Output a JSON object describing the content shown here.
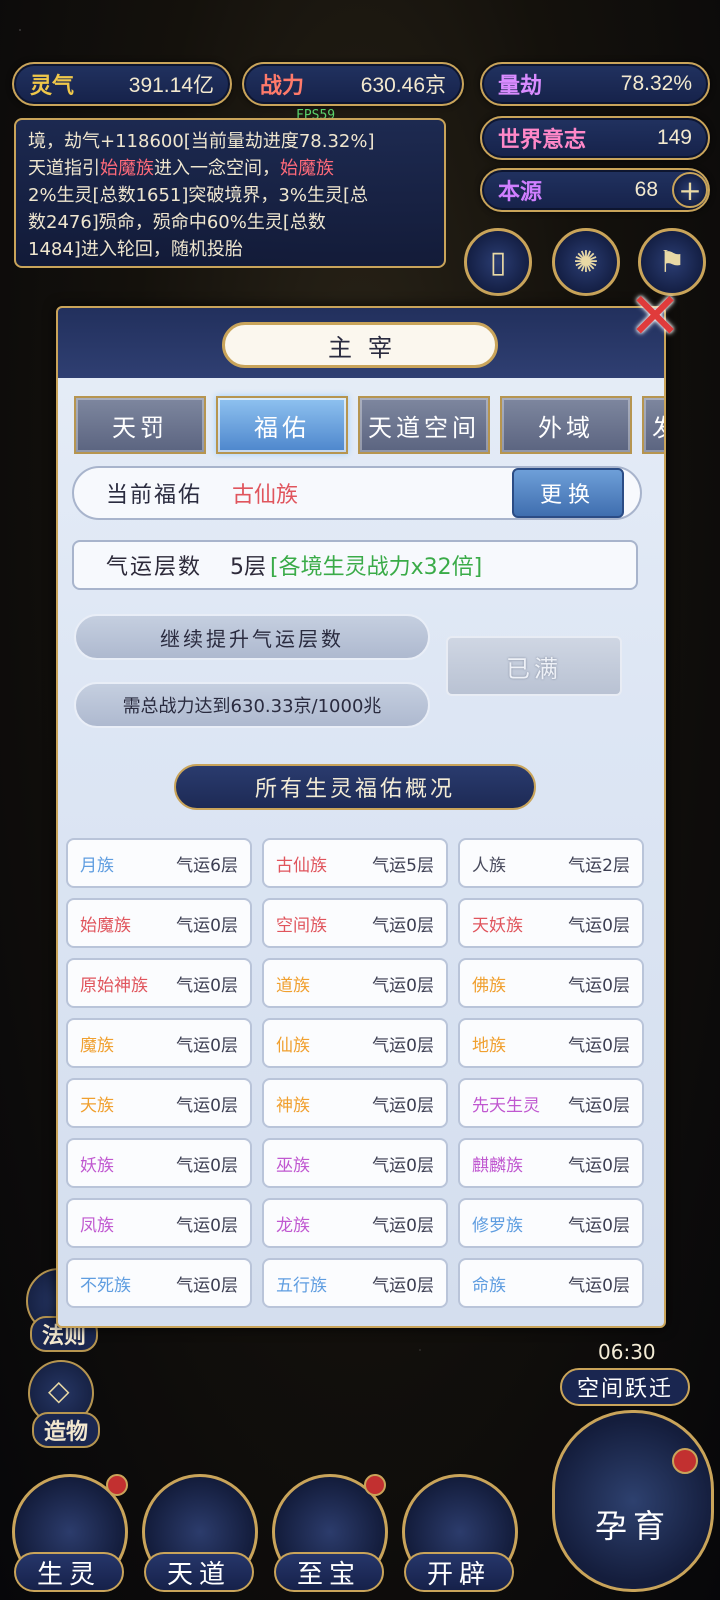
{
  "stats": {
    "lingqi": {
      "label": "灵气",
      "value": "391.14亿",
      "color": "#f0c84a"
    },
    "zhanli": {
      "label": "战力",
      "value": "630.46京",
      "color": "#ff7a6a"
    },
    "liangjie": {
      "label": "量劫",
      "value": "78.32%",
      "color": "#d98cff"
    },
    "shijie": {
      "label": "世界意志",
      "value": "149",
      "color": "#ff88c8"
    },
    "benyuan": {
      "label": "本源",
      "value": "68",
      "color": "#d07fff"
    }
  },
  "fps": "FPS59",
  "log_lines": [
    "境，劫气+118600[当前量劫进度78.32%]",
    "天道指引",
    "始魔族",
    "进入一念空间，",
    "始魔族",
    "2%生灵[总数1651]突破境界，3%生灵[总",
    "数2476]殒命，殒命中60%生灵[总数",
    "1484]进入轮回，随机投胎"
  ],
  "dialog": {
    "title": "主宰",
    "tabs": [
      "天罚",
      "福佑",
      "天道空间",
      "外域",
      "发"
    ],
    "active_tab": 1,
    "current_label": "当前福佑",
    "current_value": "古仙族",
    "change_label": "更换",
    "luck_label": "气运层数",
    "luck_value": "5层",
    "luck_bonus": "[各境生灵战力x32倍]",
    "continue_label": "继续提升气运层数",
    "require_label": "需总战力达到630.33京/1000兆",
    "full_label": "已满",
    "section_title": "所有生灵福佑概况",
    "races": [
      {
        "name": "月族",
        "level": "气运6层",
        "color": "#5f9de0"
      },
      {
        "name": "古仙族",
        "level": "气运5层",
        "color": "#e0555d"
      },
      {
        "name": "人族",
        "level": "气运2层",
        "color": "#4a4c5e"
      },
      {
        "name": "始魔族",
        "level": "气运0层",
        "color": "#e0555d"
      },
      {
        "name": "空间族",
        "level": "气运0层",
        "color": "#e0555d"
      },
      {
        "name": "天妖族",
        "level": "气运0层",
        "color": "#e0555d"
      },
      {
        "name": "原始神族",
        "level": "气运0层",
        "color": "#e0555d"
      },
      {
        "name": "道族",
        "level": "气运0层",
        "color": "#f0a030"
      },
      {
        "name": "佛族",
        "level": "气运0层",
        "color": "#f0a030"
      },
      {
        "name": "魔族",
        "level": "气运0层",
        "color": "#f0a030"
      },
      {
        "name": "仙族",
        "level": "气运0层",
        "color": "#f0a030"
      },
      {
        "name": "地族",
        "level": "气运0层",
        "color": "#f0a030"
      },
      {
        "name": "天族",
        "level": "气运0层",
        "color": "#f0a030"
      },
      {
        "name": "神族",
        "level": "气运0层",
        "color": "#f0a030"
      },
      {
        "name": "先天生灵",
        "level": "气运0层",
        "color": "#c058d0"
      },
      {
        "name": "妖族",
        "level": "气运0层",
        "color": "#c058d0"
      },
      {
        "name": "巫族",
        "level": "气运0层",
        "color": "#c058d0"
      },
      {
        "name": "麒麟族",
        "level": "气运0层",
        "color": "#c058d0"
      },
      {
        "name": "凤族",
        "level": "气运0层",
        "color": "#c058d0"
      },
      {
        "name": "龙族",
        "level": "气运0层",
        "color": "#c058d0"
      },
      {
        "name": "修罗族",
        "level": "气运0层",
        "color": "#5f9de0"
      },
      {
        "name": "不死族",
        "level": "气运0层",
        "color": "#5f9de0"
      },
      {
        "name": "五行族",
        "level": "气运0层",
        "color": "#5f9de0"
      },
      {
        "name": "命族",
        "level": "气运0层",
        "color": "#5f9de0"
      }
    ]
  },
  "side": {
    "fa_ze": "法则",
    "zao_wu": "造物",
    "timer": "06:30",
    "jump": "空间跃迁"
  },
  "bottom": [
    "生灵",
    "天道",
    "至宝",
    "开辟"
  ],
  "yun_yu": "孕育"
}
